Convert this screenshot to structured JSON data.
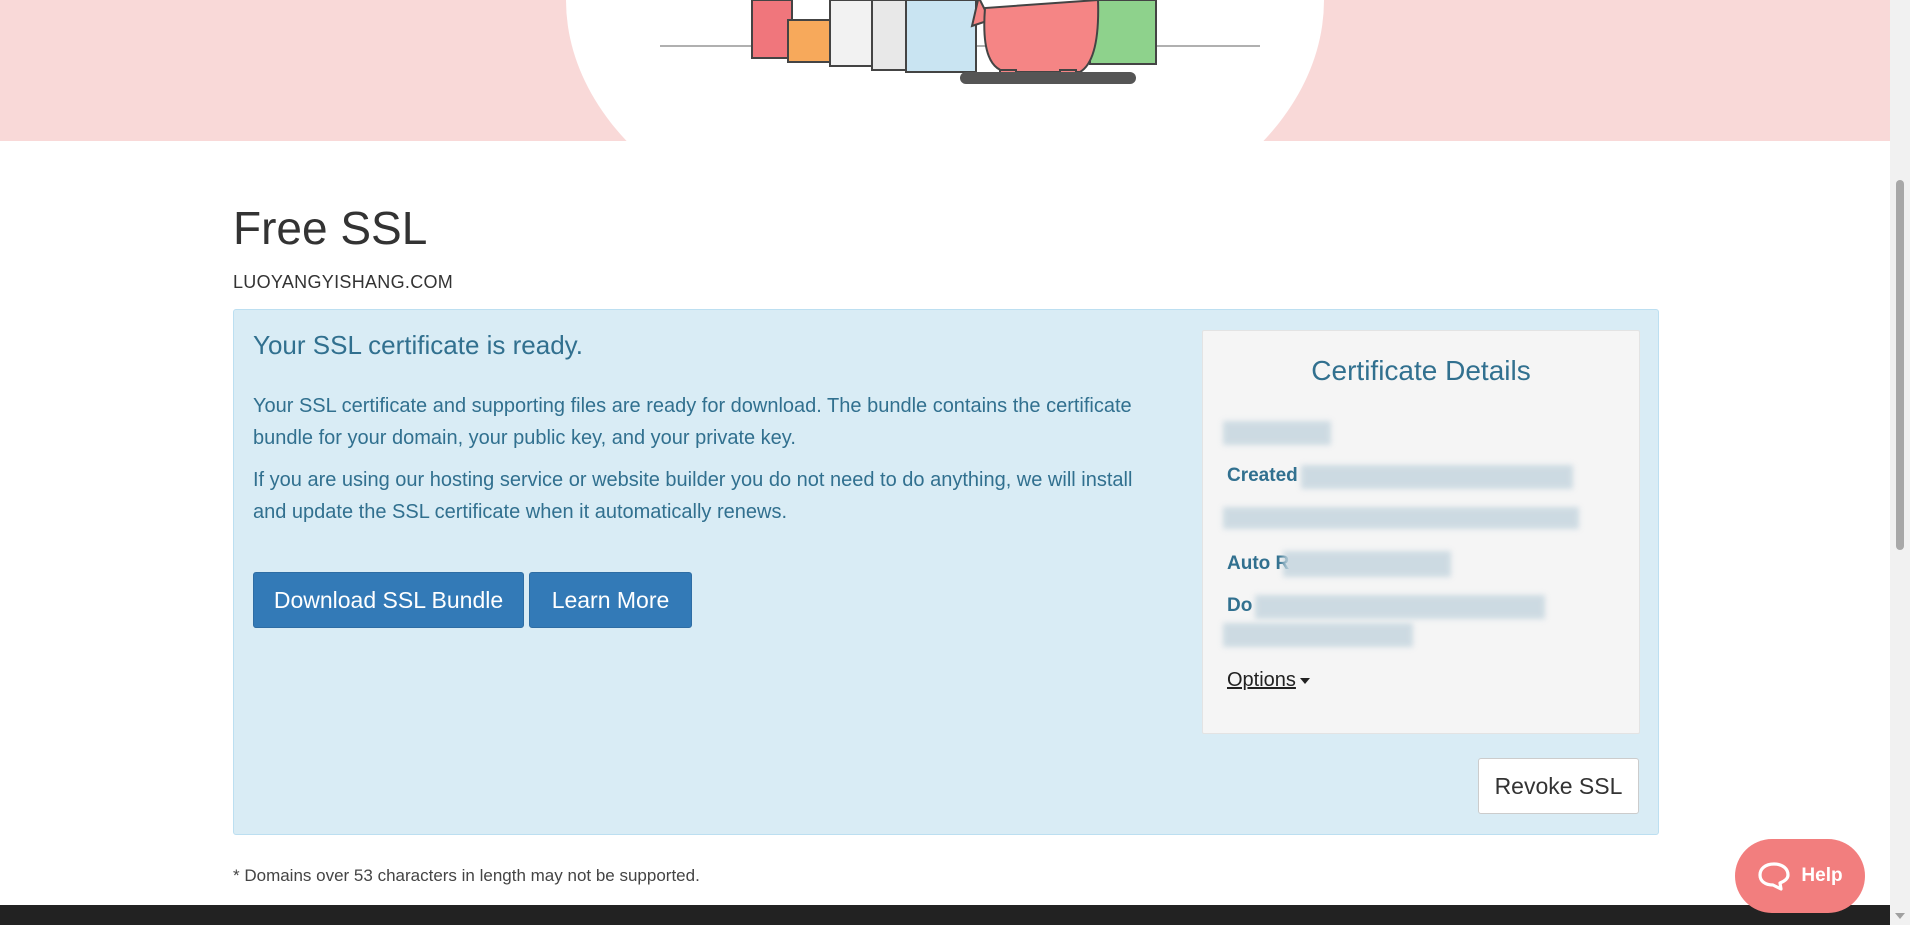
{
  "page": {
    "title": "Free SSL",
    "domain": "LUOYANGYISHANG.COM"
  },
  "ssl_panel": {
    "heading": "Your SSL certificate is ready.",
    "paragraph_1": "Your SSL certificate and supporting files are ready for download. The bundle contains the certificate bundle for your domain, your public key, and your private key.",
    "paragraph_2": "If you are using our hosting service or website builder you do not need to do anything, we will install and update the SSL certificate when it automatically renews.",
    "download_label": "Download SSL Bundle",
    "learn_more_label": "Learn More",
    "revoke_label": "Revoke SSL"
  },
  "details": {
    "title": "Certificate Details",
    "created_label": "Created",
    "auto_label": "Auto R",
    "d_label": "Do",
    "options_label": "Options"
  },
  "footnote": "* Domains over 53 characters in length may not be supported.",
  "help": {
    "label": "Help"
  },
  "colors": {
    "hero_bg": "#f9d9d8",
    "panel_bg": "#d9ecf5",
    "primary": "#337ab7",
    "info_text": "#31708f",
    "help_bg": "#f27e7e"
  }
}
